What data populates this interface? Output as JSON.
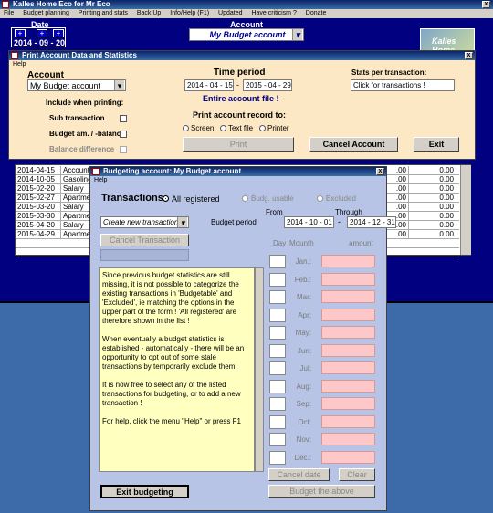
{
  "main": {
    "title": "Kalles Home Eco for Mr Eco",
    "menu": [
      "File",
      "Budget planning",
      "Printing and stats",
      "Back Up",
      "Info/Help (F1)",
      "Updated",
      "Have criticism ?",
      "Donate"
    ],
    "date_label": "Date",
    "date_value": "2014 - 09 - 20",
    "plus": "+",
    "account_label": "Account",
    "account_value": "My Budget account",
    "logo_text": "Kalles Home"
  },
  "print_dialog": {
    "title": "Print Account Data and Statistics",
    "menu": "Help",
    "account_heading": "Account",
    "account_value": "My Budget account",
    "include_heading": "Include when printing:",
    "sub_transaction": "Sub transaction",
    "budget_balance": "Budget am. / -balance",
    "balance_difference": "Balance difference",
    "time_period_heading": "Time period",
    "date_from": "2014 - 04 - 15",
    "date_to": "2015 - 04 - 29",
    "dash": "-",
    "entire_file": "Entire account file !",
    "print_record_heading": "Print account record to:",
    "opt_screen": "Screen",
    "opt_text_file": "Text file",
    "opt_printer": "Printer",
    "print_btn": "Print",
    "stats_heading": "Stats per transaction:",
    "stats_field": "Click for transactions !",
    "cancel_account_btn": "Cancel Account",
    "exit_btn": "Exit"
  },
  "transactions_table": {
    "rows": [
      {
        "date": "2014-04-15",
        "name": "Account s",
        "amount1": ".00",
        "amount2": "0,00"
      },
      {
        "date": "2014-10-05",
        "name": "Gasoline",
        "amount1": ".00",
        "amount2": "0.00"
      },
      {
        "date": "2015-02-20",
        "name": "Salary",
        "amount1": ".00",
        "amount2": "0.00"
      },
      {
        "date": "2015-02-27",
        "name": "Apartmer",
        "amount1": ".00",
        "amount2": "0.00"
      },
      {
        "date": "2015-03-20",
        "name": "Salary",
        "amount1": ".00",
        "amount2": "0.00"
      },
      {
        "date": "2015-03-30",
        "name": "Apartmer",
        "amount1": ".00",
        "amount2": "0.00"
      },
      {
        "date": "2015-04-20",
        "name": "Salary",
        "amount1": ".00",
        "amount2": "0.00"
      },
      {
        "date": "2015-04-29",
        "name": "Apartmer",
        "amount1": ".00",
        "amount2": "0.00"
      }
    ]
  },
  "budget_dialog": {
    "title": "Budgeting account: My Budget account",
    "menu": "Help",
    "transactions_label": "Transactions",
    "all_registered": "All registered",
    "budg_usable": "Budg. usable",
    "excluded": "Excluded",
    "create_new": "Create new transaction",
    "budget_period_label": "Budget period",
    "from_label": "From",
    "through_label": "Through",
    "from_value": "2014 - 10 - 01",
    "through_value": "2014 - 12 - 31",
    "dash": "-",
    "cancel_transaction_btn": "Cancel Transaction",
    "info_p1": "Since previous budget statistics are still missing, it is not possible to categorize the existing transactions in 'Budgetable' and 'Excluded', ie matching the options in the upper part of the form !  'All registered' are therefore shown in the list !",
    "info_p2": "When eventually a budget statistics is established - automatically - there will be an opportunity to opt out of some stale transactions by temporarily exclude them.",
    "info_p3": "It is now free to select any of the listed transactions for budgeting, or to add a new transaction !",
    "info_p4": "For help, click the menu \"Help\" or press F1",
    "day_label": "Day",
    "month_label": "Mounth",
    "amount_label": "amount",
    "months": [
      "Jan.:",
      "Feb.:",
      "Mar:",
      "Apr:",
      "May:",
      "Jun:",
      "Jul:",
      "Aug:",
      "Sep:",
      "Oct:",
      "Nov:",
      "Dec.:"
    ],
    "cancel_date_btn": "Cancel date",
    "clear_btn": "Clear",
    "exit_budgeting_btn": "Exit budgeting",
    "budget_above_btn": "Budget the above"
  }
}
